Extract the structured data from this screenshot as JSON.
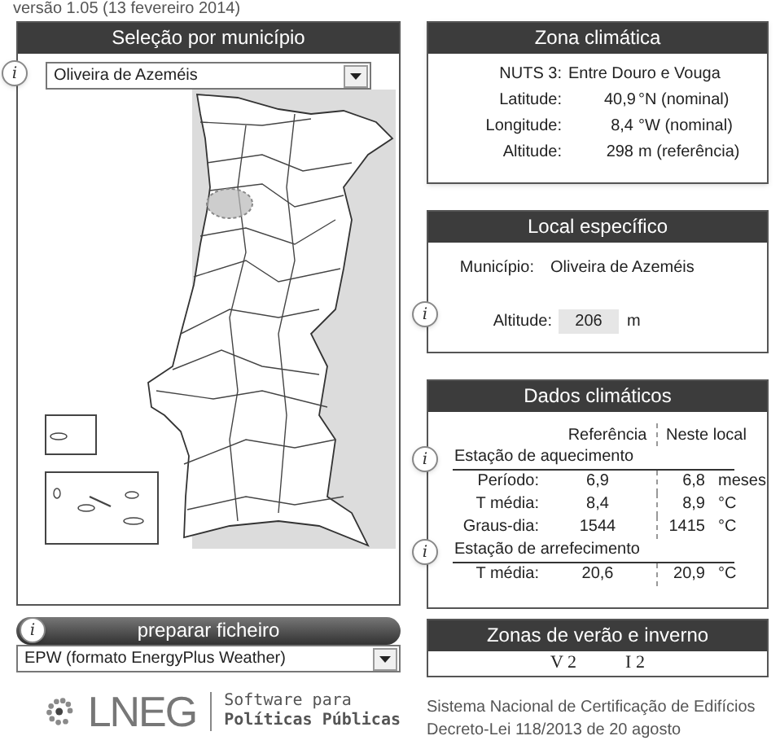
{
  "version": "versão 1.05  (13 fevereiro 2014)",
  "municipality_panel": {
    "title": "Seleção por município",
    "info": "i",
    "municipality": "Oliveira de Azeméis"
  },
  "file_panel": {
    "info": "i",
    "button": "preparar ficheiro",
    "format": "EPW (formato EnergyPlus Weather)"
  },
  "logo": {
    "name": "LNEG",
    "tagline_1": "Software para",
    "tagline_2": "Políticas Públicas"
  },
  "climate_zone": {
    "title": "Zona climática",
    "rows": [
      {
        "label": "NUTS 3:",
        "value": "Entre Douro e Vouga",
        "unit": ""
      },
      {
        "label": "Latitude:",
        "value": "40,9",
        "unit": "°N (nominal)"
      },
      {
        "label": "Longitude:",
        "value": "8,4",
        "unit": "°W (nominal)"
      },
      {
        "label": "Altitude:",
        "value": "298",
        "unit": "m (referência)"
      }
    ]
  },
  "local": {
    "title": "Local específico",
    "municipality_label": "Município:",
    "municipality": "Oliveira de Azeméis",
    "info": "i",
    "altitude_label": "Altitude:",
    "altitude": "206",
    "altitude_unit": "m"
  },
  "climate_data": {
    "title": "Dados climáticos",
    "columns": [
      "Referência",
      "Neste local"
    ],
    "sections": [
      {
        "title": "Estação de aquecimento",
        "info": "i",
        "rows": [
          {
            "label": "Período:",
            "reference": "6,9",
            "local": "6,8",
            "unit": "meses"
          },
          {
            "label": "T média:",
            "reference": "8,4",
            "local": "8,9",
            "unit": "°C"
          },
          {
            "label": "Graus-dia:",
            "reference": "1544",
            "local": "1415",
            "unit": "°C"
          }
        ]
      },
      {
        "title": "Estação de arrefecimento",
        "info": "i",
        "rows": [
          {
            "label": "T média:",
            "reference": "20,6",
            "local": "20,9",
            "unit": "°C"
          }
        ]
      }
    ]
  },
  "zones": {
    "title": "Zonas de verão e inverno",
    "summer": "V 2",
    "winter": "I 2"
  },
  "footer": [
    "Sistema Nacional de Certificação de Edifícios",
    "Decreto-Lei 118/2013 de 20 agosto"
  ]
}
